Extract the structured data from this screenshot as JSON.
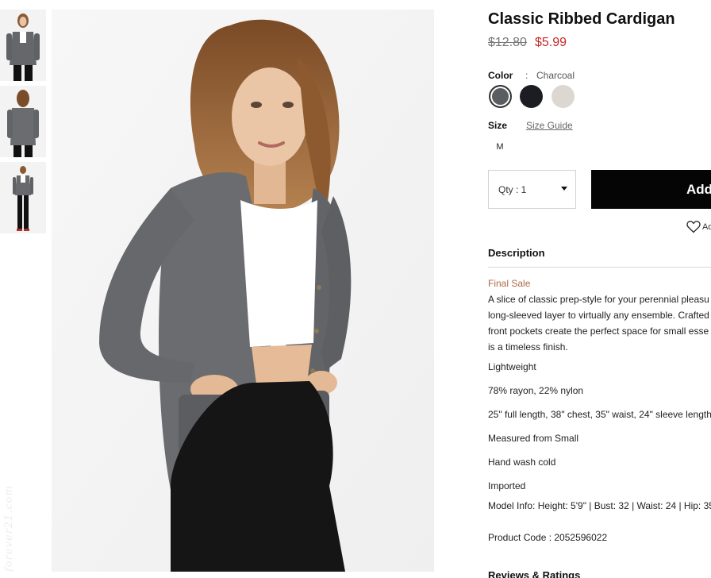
{
  "product": {
    "title": "Classic Ribbed Cardigan",
    "price_original": "$12.80",
    "price_sale": "$5.99",
    "color_label": "Color",
    "color_separator": ":",
    "color_selected": "Charcoal",
    "colors": [
      {
        "name": "Charcoal",
        "hex": "#5a5d62"
      },
      {
        "name": "Black",
        "hex": "#1b1d22"
      },
      {
        "name": "Heather Grey",
        "hex": "#ddd7d2"
      }
    ],
    "size_label": "Size",
    "size_guide": "Size Guide",
    "sizes": [
      "M"
    ],
    "qty_label": "Qty : 1",
    "add_to_bag": "Add",
    "wishlist": "Ad"
  },
  "description": {
    "heading": "Description",
    "final_sale": "Final Sale",
    "text_lines": [
      "A slice of classic prep-style for your perennial pleasu",
      "long-sleeved layer to virtually any ensemble. Crafted",
      "front pockets create the perfect space for small esse",
      "is a timeless finish."
    ],
    "features": [
      "Lightweight",
      "78% rayon, 22% nylon",
      "25\" full length, 38\" chest, 35\" waist, 24\" sleeve length",
      "Measured from Small",
      "Hand wash cold",
      "Imported",
      "Model Info: Height: 5'9\" | Bust: 32 | Waist: 24 | Hip: 35"
    ],
    "product_code": "Product Code : 2052596022"
  },
  "reviews": {
    "heading": "Reviews & Ratings"
  },
  "watermark": "forever21.com",
  "colors": {
    "sale_price": "#c62828",
    "final_sale": "#b0684a",
    "button_bg": "#050505",
    "cardigan": "#6b6c6f"
  }
}
